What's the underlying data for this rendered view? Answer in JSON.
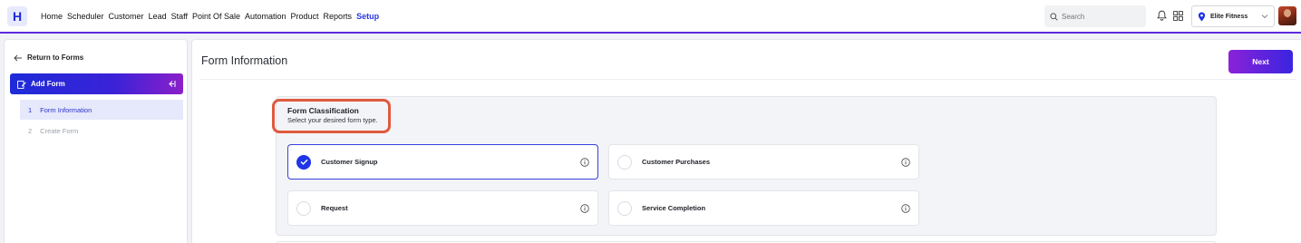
{
  "app": {
    "logo_letter": "H"
  },
  "nav": {
    "items": [
      "Home",
      "Scheduler",
      "Customer",
      "Lead",
      "Staff",
      "Point Of Sale",
      "Automation",
      "Product",
      "Reports",
      "Setup"
    ],
    "active": "Setup"
  },
  "header": {
    "search_placeholder": "Search",
    "location": "Elite Fitness"
  },
  "sidebar": {
    "return_label": "Return to Forms",
    "add_form_label": "Add Form",
    "steps": [
      {
        "num": "1",
        "label": "Form Information",
        "active": true
      },
      {
        "num": "2",
        "label": "Create Form",
        "active": false
      }
    ]
  },
  "main": {
    "title": "Form Information",
    "next_label": "Next",
    "classification": {
      "title": "Form Classification",
      "subtitle": "Select your desired form type.",
      "options": [
        {
          "label": "Customer Signup",
          "selected": true
        },
        {
          "label": "Customer Purchases",
          "selected": false
        },
        {
          "label": "Request",
          "selected": false
        },
        {
          "label": "Service Completion",
          "selected": false
        }
      ]
    }
  },
  "colors": {
    "accent": "#2a34e6",
    "highlight": "#e05a3f",
    "gradient_start": "#1e2bd8",
    "gradient_end": "#8b1fc9"
  }
}
